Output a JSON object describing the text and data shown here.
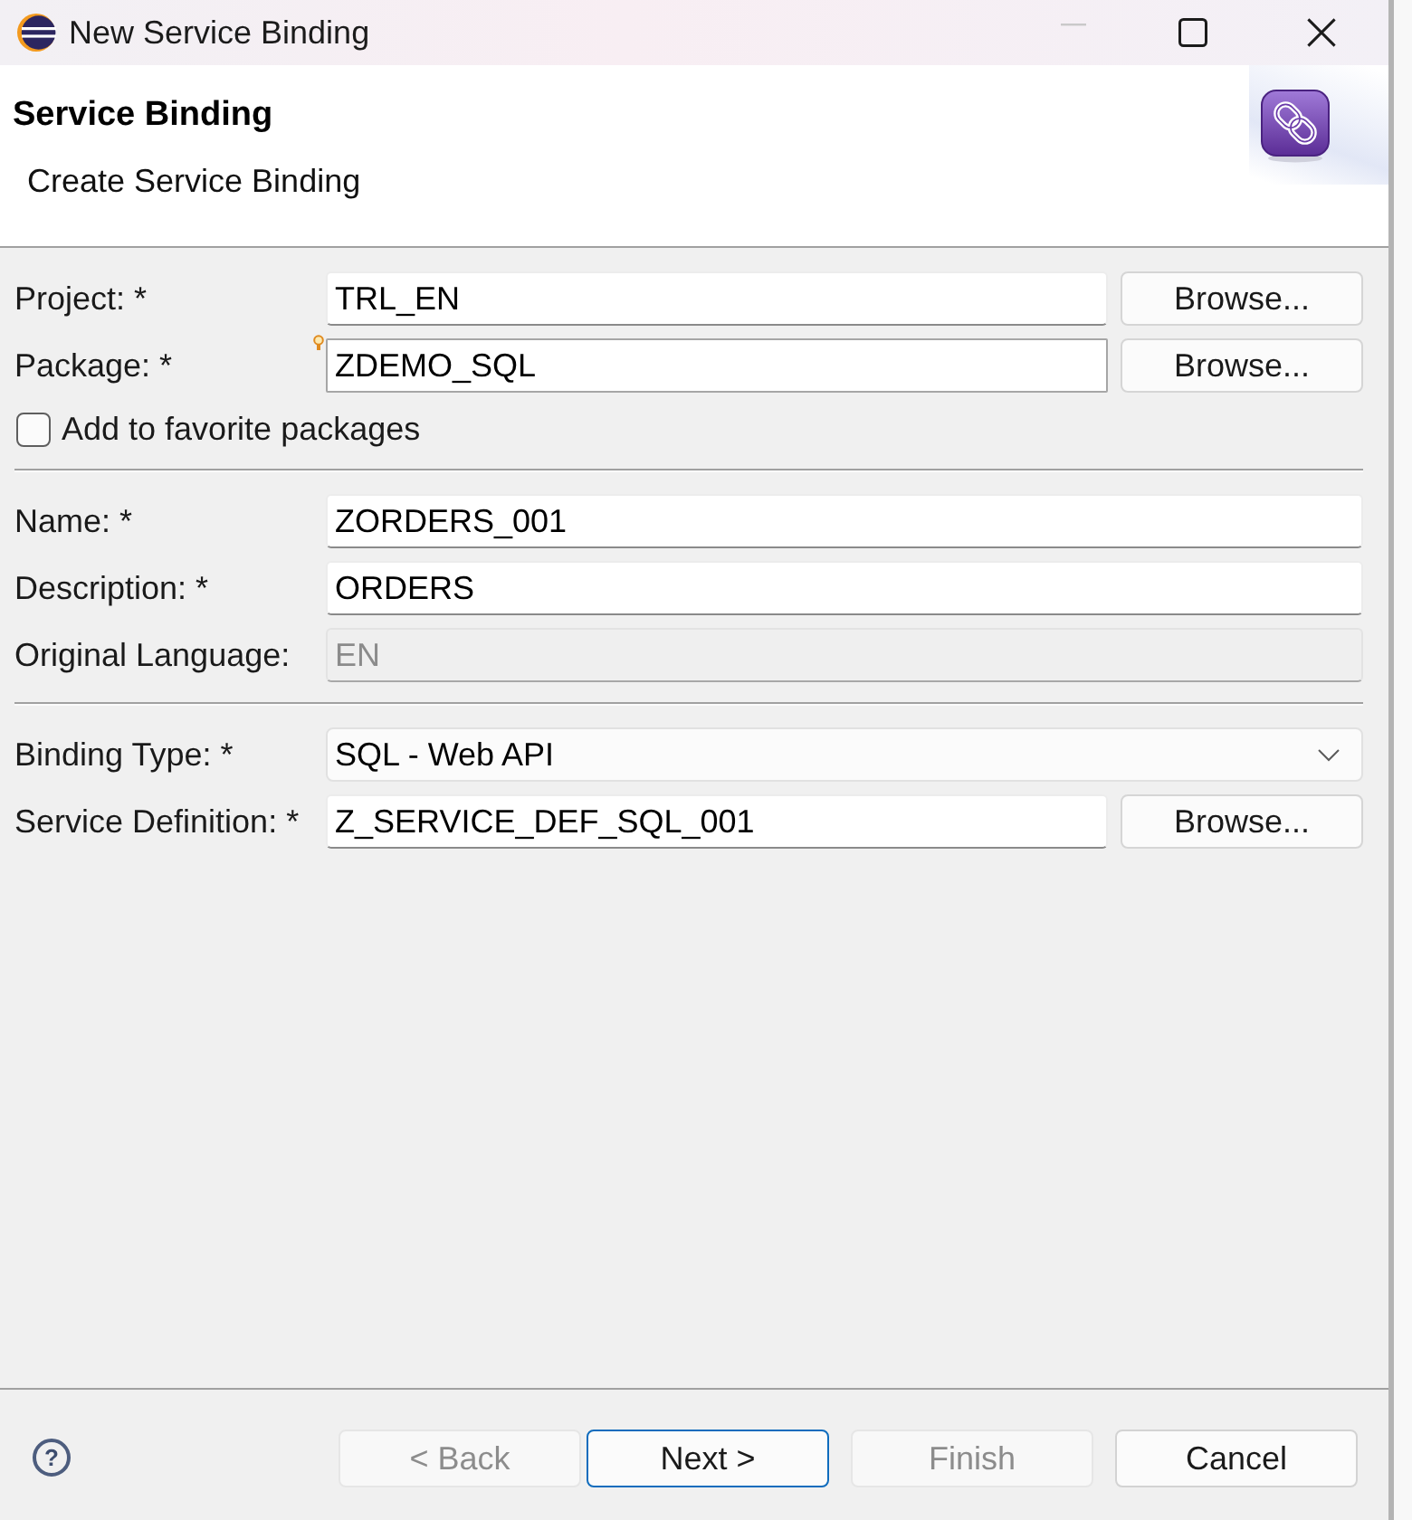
{
  "window": {
    "title": "New Service Binding",
    "controls": [
      {
        "kind": "minimize",
        "disabled": true
      },
      {
        "kind": "maximize",
        "disabled": false
      },
      {
        "kind": "close",
        "disabled": false
      }
    ]
  },
  "header": {
    "title": "Service Binding",
    "description": "Create Service Binding"
  },
  "sections": [
    {
      "fields": [
        {
          "kind": "text",
          "label": "Project: *",
          "value": "TRL_EN",
          "focused": false,
          "disabled": false,
          "assist_hint": false,
          "browse": {
            "label": "Browse..."
          }
        },
        {
          "kind": "text",
          "label": "Package: *",
          "value": "ZDEMO_SQL",
          "focused": true,
          "disabled": false,
          "assist_hint": true,
          "browse": {
            "label": "Browse..."
          }
        },
        {
          "kind": "checkbox",
          "label": "Add to favorite packages",
          "checked": false
        }
      ]
    },
    {
      "fields": [
        {
          "kind": "text",
          "label": "Name: *",
          "value": "ZORDERS_001",
          "focused": false,
          "disabled": false,
          "assist_hint": false
        },
        {
          "kind": "text",
          "label": "Description: *",
          "value": "ORDERS",
          "focused": false,
          "disabled": false,
          "assist_hint": false
        },
        {
          "kind": "text",
          "label": "Original Language:",
          "value": "EN",
          "focused": false,
          "disabled": true,
          "assist_hint": false
        }
      ]
    },
    {
      "fields": [
        {
          "kind": "dropdown",
          "label": "Binding Type: *",
          "value": "SQL - Web API"
        },
        {
          "kind": "text",
          "label": "Service Definition: *",
          "value": "Z_SERVICE_DEF_SQL_001",
          "focused": false,
          "disabled": false,
          "assist_hint": false,
          "browse": {
            "label": "Browse..."
          }
        }
      ]
    }
  ],
  "footer": {
    "help": "?",
    "buttons": [
      {
        "label": "< Back",
        "disabled": true,
        "default": false
      },
      {
        "label": "Next >",
        "disabled": false,
        "default": true
      },
      {
        "label": "Finish",
        "disabled": true,
        "default": false
      },
      {
        "label": "Cancel",
        "disabled": false,
        "default": false
      }
    ]
  }
}
